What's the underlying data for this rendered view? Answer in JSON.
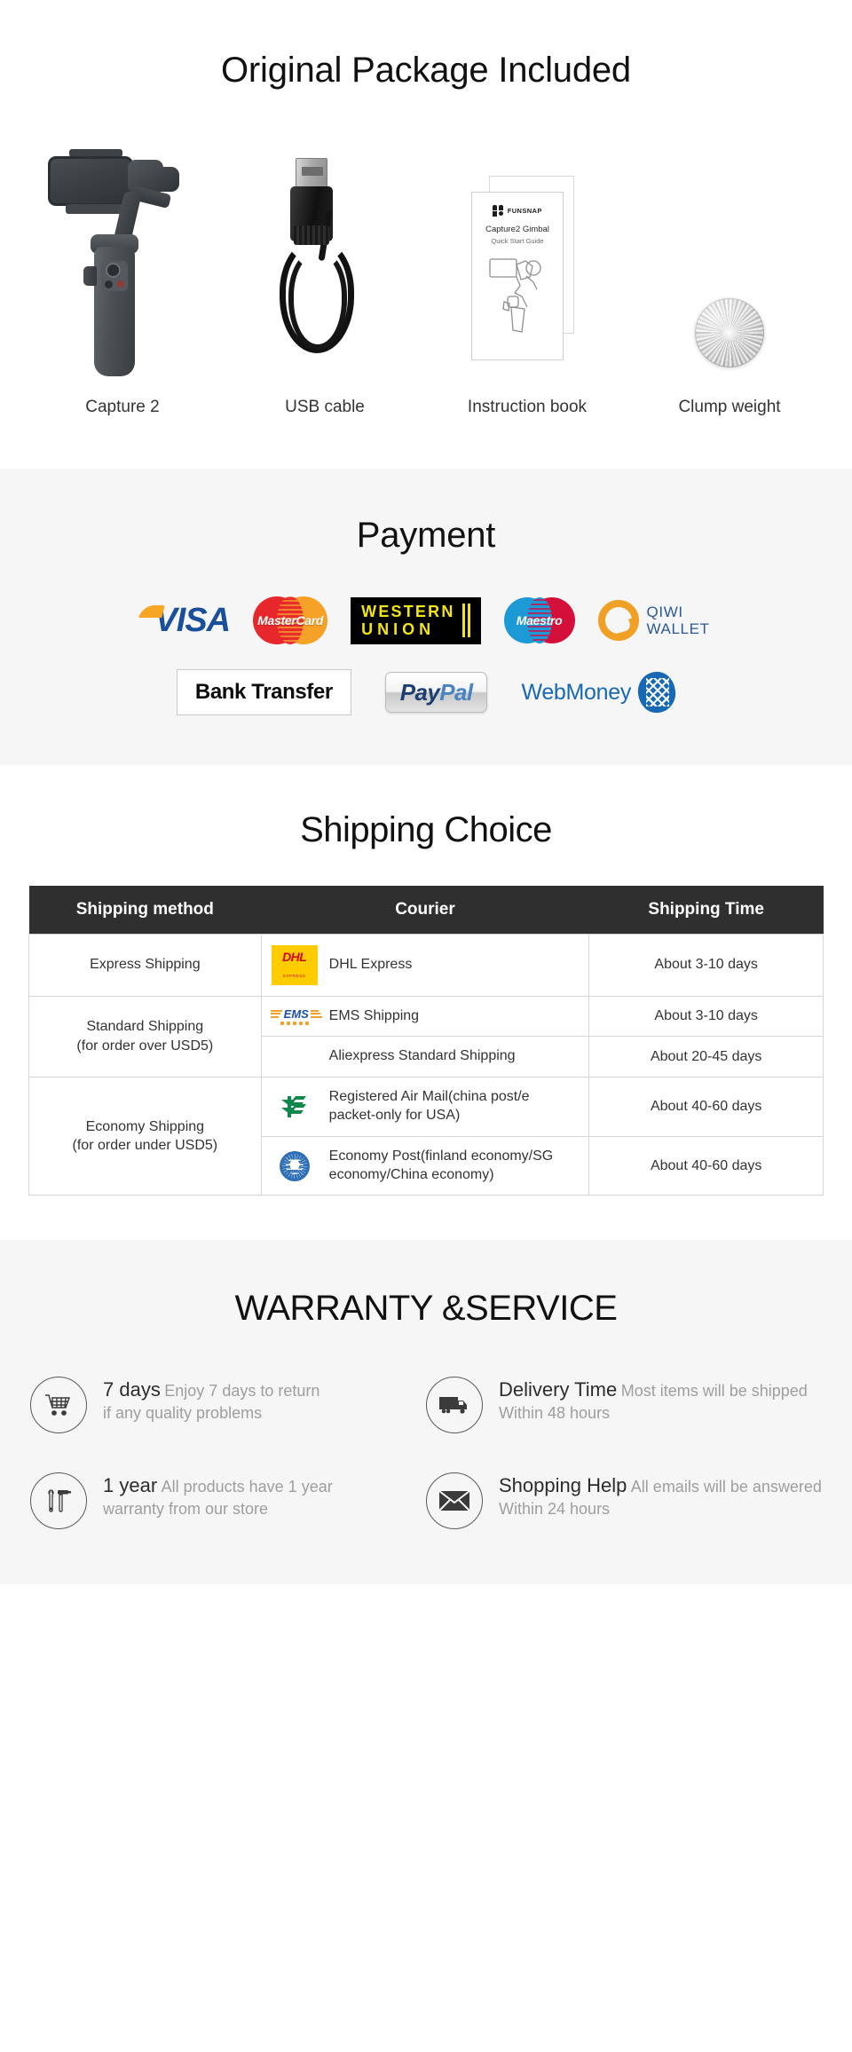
{
  "package": {
    "title": "Original Package Included",
    "items": [
      {
        "label": "Capture 2",
        "icon": "gimbal-icon"
      },
      {
        "label": "USB cable",
        "icon": "usb-cable-icon"
      },
      {
        "label": "Instruction book",
        "icon": "manual-icon"
      },
      {
        "label": "Clump weight",
        "icon": "counterweight-icon"
      }
    ],
    "manual": {
      "brand": "FUNSNAP",
      "title": "Capture2 Gimbal",
      "subtitle": "Quick Start Guide"
    }
  },
  "payment": {
    "title": "Payment",
    "methods_row1": [
      {
        "name": "VISA",
        "icon": "visa-logo",
        "color": "#1a4f9c"
      },
      {
        "name": "MasterCard",
        "icon": "mastercard-logo",
        "color": "#e8272c"
      },
      {
        "name": "WESTERN UNION",
        "line1": "WESTERN",
        "line2": "UNION",
        "icon": "western-union-logo",
        "color": "#f2e512"
      },
      {
        "name": "Maestro",
        "icon": "maestro-logo",
        "color": "#1c9ad6"
      },
      {
        "name": "QIWI WALLET",
        "line1": "QIWI",
        "line2": "WALLET",
        "icon": "qiwi-wallet-logo",
        "color": "#f0a024"
      }
    ],
    "methods_row2": [
      {
        "name": "Bank Transfer",
        "icon": "bank-transfer-logo",
        "color": "#0d0d0d"
      },
      {
        "name": "PayPal",
        "part1": "Pay",
        "part2": "Pal",
        "icon": "paypal-logo",
        "color": "#1c3e73"
      },
      {
        "name": "WebMoney",
        "icon": "webmoney-logo",
        "color": "#1769b5"
      }
    ]
  },
  "shipping": {
    "title": "Shipping Choice",
    "columns": [
      "Shipping method",
      "Courier",
      "Shipping Time"
    ],
    "rows": [
      {
        "method": "Express Shipping",
        "method_line1": "Express Shipping",
        "method_line2": "",
        "couriers": [
          {
            "logo": "dhl-logo",
            "name": "DHL Express",
            "time": "About 3-10 days"
          }
        ]
      },
      {
        "method": "Standard Shipping (for order over USD5)",
        "method_line1": "Standard Shipping",
        "method_line2": "(for order over USD5)",
        "couriers": [
          {
            "logo": "ems-logo",
            "name": "EMS Shipping",
            "time": "About 3-10 days"
          },
          {
            "logo": "none",
            "name": "Aliexpress Standard Shipping",
            "time": "About 20-45 days"
          }
        ]
      },
      {
        "method": "Economy Shipping (for order under USD5)",
        "method_line1": "Economy Shipping",
        "method_line2": "(for order under USD5)",
        "couriers": [
          {
            "logo": "china-post-logo",
            "name": "Registered Air Mail(china post/e packet-only for USA)",
            "time": "About 40-60 days"
          },
          {
            "logo": "un-post-logo",
            "name": "Economy Post(finland economy/SG economy/China economy)",
            "time": "About 40-60 days"
          }
        ]
      }
    ]
  },
  "warranty": {
    "title": "WARRANTY &SERVICE",
    "items": [
      {
        "icon": "shopping-cart-icon",
        "title": "7 days",
        "desc_line1": "Enjoy 7 days to return",
        "desc_line2": "if any quality problems"
      },
      {
        "icon": "delivery-truck-icon",
        "title": "Delivery Time",
        "desc_line1": "Most items will be shipped",
        "desc_line2": "Within 48 hours"
      },
      {
        "icon": "tools-icon",
        "title": "1 year",
        "desc_line1": "All products have 1 year",
        "desc_line2": "warranty from our store"
      },
      {
        "icon": "envelope-icon",
        "title": "Shopping Help",
        "desc_line1": "All emails will be answered",
        "desc_line2": "Within 24 hours"
      }
    ]
  }
}
